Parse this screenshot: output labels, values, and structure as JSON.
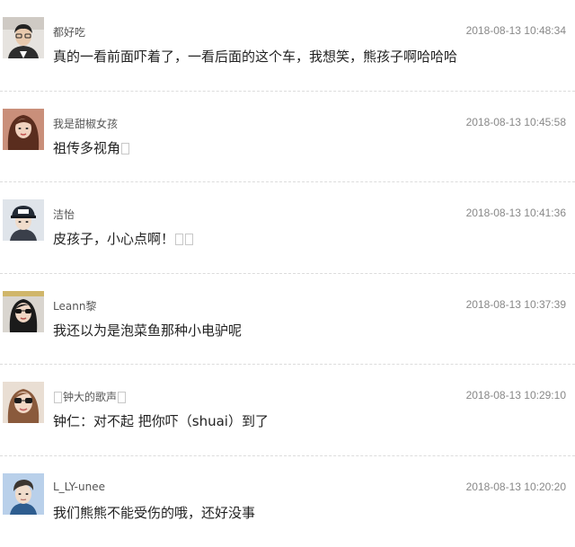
{
  "comments": [
    {
      "name": "都好吃",
      "time": "2018-08-13 10:48:34",
      "text": "真的一看前面吓着了，一看后面的这个车，我想笑，熊孩子啊哈哈哈",
      "avatar": "avatar-male-glasses"
    },
    {
      "name": "我是甜椒女孩",
      "time": "2018-08-13 10:45:58",
      "text": "祖传多视角",
      "avatar": "avatar-female-long-hair"
    },
    {
      "name": "洁怡",
      "time": "2018-08-13 10:41:36",
      "text": "皮孩子，小心点啊！",
      "avatar": "avatar-person-cap"
    },
    {
      "name": "Leann黎",
      "time": "2018-08-13 10:37:39",
      "text": "我还以为是泡菜鱼那种小电驴呢",
      "avatar": "avatar-female-sunglasses"
    },
    {
      "name": "钟大的歌声",
      "time": "2018-08-13 10:29:10",
      "text": "钟仁：对不起 把你吓（shuai）到了",
      "avatar": "avatar-female-sunglasses-2"
    },
    {
      "name": "L_LY-unee",
      "time": "2018-08-13 10:20:20",
      "text": "我们熊熊不能受伤的哦，还好没事",
      "avatar": "avatar-male-blue"
    }
  ]
}
